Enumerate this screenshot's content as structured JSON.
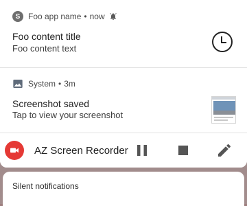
{
  "notifications": [
    {
      "app_letter": "S",
      "app_name": "Foo app name",
      "time": "now",
      "title": "Foo content title",
      "text": "Foo content text",
      "icon": "clock-icon"
    },
    {
      "app_name": "System",
      "time": "3m",
      "title": "Screenshot saved",
      "text": "Tap to view your screenshot",
      "icon": "image-icon"
    }
  ],
  "recorder": {
    "name": "AZ Screen Recorder",
    "accent": "#e53935",
    "controls": [
      "pause-icon",
      "stop-icon",
      "edit-icon"
    ]
  },
  "silent": {
    "label": "Silent notifications"
  },
  "separator": "•"
}
